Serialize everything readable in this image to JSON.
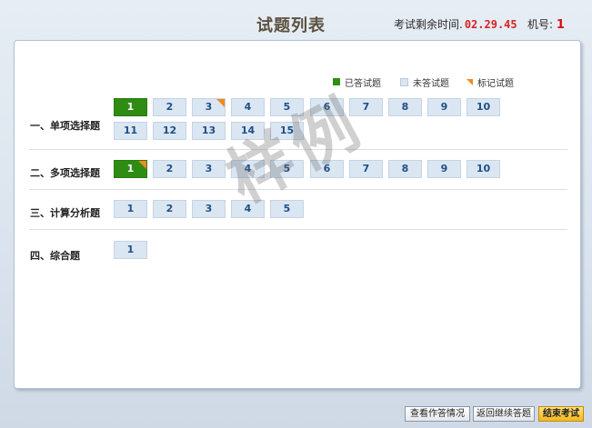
{
  "header": {
    "title": "试题列表",
    "timer_label": "考试剩余时间.",
    "timer_value": "02.29.45",
    "machine_label": "机号:",
    "machine_number": "1"
  },
  "legend": {
    "answered": "已答试题",
    "unanswered": "未答试题",
    "flagged": "标记试题"
  },
  "sections": [
    {
      "label": "一、单项选择题",
      "questions": [
        "1",
        "2",
        "3",
        "4",
        "5",
        "6",
        "7",
        "8",
        "9",
        "10",
        "11",
        "12",
        "13",
        "14",
        "15"
      ]
    },
    {
      "label": "二、多项选择题",
      "questions": [
        "1",
        "2",
        "3",
        "4",
        "5",
        "6",
        "7",
        "8",
        "9",
        "10"
      ]
    },
    {
      "label": "三、计算分析题",
      "questions": [
        "1",
        "2",
        "3",
        "4",
        "5"
      ]
    },
    {
      "label": "四、综合题",
      "questions": [
        "1"
      ]
    }
  ],
  "watermark": "样例",
  "buttons": {
    "view_answers": "查看作答情况",
    "return_continue": "返回继续答题",
    "end_exam": "结束考试"
  },
  "colors": {
    "answered": "#2e8c12",
    "unanswered": "#dbe6f3",
    "flag": "#f08a1c",
    "timer": "#d82222",
    "end_button": "#f5b81b"
  }
}
